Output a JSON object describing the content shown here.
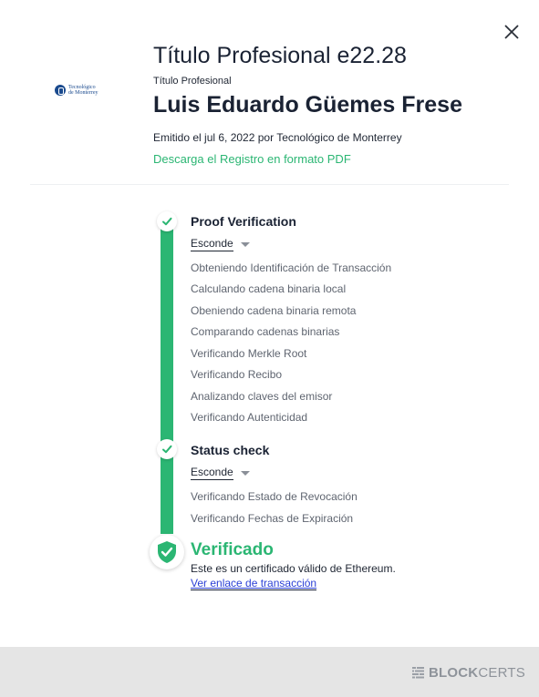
{
  "header": {
    "title": "Título Profesional e22.28",
    "subtitle": "Título Profesional",
    "recipient": "Luis Eduardo Güemes Frese",
    "issued": "Emitido el jul 6, 2022 por Tecnológico de Monterrey",
    "download_label": "Descarga el Registro en formato PDF",
    "logo_line1": "Tecnológico",
    "logo_line2": "de Monterrey"
  },
  "steps": [
    {
      "title": "Proof Verification",
      "toggle_label": "Esconde",
      "substeps": [
        "Obteniendo Identificación de Transacción",
        "Calculando cadena binaria local",
        "Obeniendo cadena binaria remota",
        "Comparando cadenas binarias",
        "Verificando Merkle Root",
        "Verificando Recibo",
        "Analizando claves del emisor",
        "Verificando Autenticidad"
      ]
    },
    {
      "title": "Status check",
      "toggle_label": "Esconde",
      "substeps": [
        "Verificando Estado de Revocación",
        "Verificando Fechas de Expiración"
      ]
    }
  ],
  "result": {
    "title": "Verificado",
    "description": "Este es un certificado válido de Ethereum.",
    "link_label": "Ver enlace de transacción"
  },
  "footer": {
    "brand_bold": "BLOCK",
    "brand_light": "CERTS"
  },
  "colors": {
    "accent": "#2bb673",
    "link": "#2a3fd6",
    "footer_bg": "#e5e5e5"
  },
  "icons": {
    "close": "close-icon",
    "step_check": "check-icon",
    "verified": "shield-check-icon",
    "brand": "blockcerts-logo-icon",
    "toggle_caret": "caret-down-icon"
  }
}
